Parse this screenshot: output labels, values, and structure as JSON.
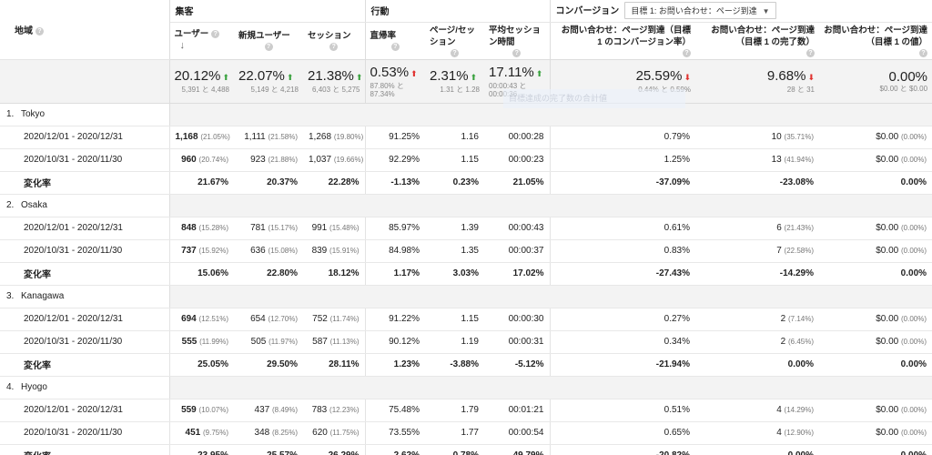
{
  "header": {
    "region_label": "地域",
    "group_acquisition": "集客",
    "group_behavior": "行動",
    "group_conversion": "コンバージョン",
    "goal_select_value": "目標 1: お問い合わせ：ページ到達",
    "columns": [
      "ユーザー",
      "新規ユーザー",
      "セッション",
      "直帰率",
      "ページ/セッション",
      "平均セッション時間",
      "お問い合わせ：ページ到達（目標 1 のコンバージョン率）",
      "お問い合わせ：ページ到達（目標 1 の完了数）",
      "お問い合わせ：ページ到達（目標 1 の値）"
    ],
    "help_icon_text": "?"
  },
  "summary": [
    {
      "value": "20.12%",
      "dir": "up",
      "sub": "5,391 と 4,488"
    },
    {
      "value": "22.07%",
      "dir": "up",
      "sub": "5,149 と 4,218"
    },
    {
      "value": "21.38%",
      "dir": "up",
      "sub": "6,403 と 5,275"
    },
    {
      "value": "0.53%",
      "dir": "up-red",
      "sub": "87.80% と 87.34%"
    },
    {
      "value": "2.31%",
      "dir": "up",
      "sub": "1.31 と 1.28"
    },
    {
      "value": "17.11%",
      "dir": "up",
      "sub": "00:00:43 と 00:00:36"
    },
    {
      "value": "25.59%",
      "dir": "down",
      "sub": "0.44% と 0.59%"
    },
    {
      "value": "9.68%",
      "dir": "down",
      "sub": "28 と 31"
    },
    {
      "value": "0.00%",
      "dir": "",
      "sub": "$0.00 と $0.00"
    }
  ],
  "tooltip_ghost": "目標達成の完了数の合計値",
  "change_label": "変化率",
  "regions": [
    {
      "index": "1.",
      "name": "Tokyo",
      "rows": [
        {
          "period": "2020/12/01 - 2020/12/31",
          "users": "1,168",
          "users_pct": "(21.05%)",
          "new": "1,111",
          "new_pct": "(21.58%)",
          "sess": "1,268",
          "sess_pct": "(19.80%)",
          "bounce": "91.25%",
          "pps": "1.16",
          "dur": "00:00:28",
          "cvr": "0.79%",
          "comp": "10",
          "comp_pct": "(35.71%)",
          "val": "$0.00",
          "val_pct": "(0.00%)"
        },
        {
          "period": "2020/10/31 - 2020/11/30",
          "users": "960",
          "users_pct": "(20.74%)",
          "new": "923",
          "new_pct": "(21.88%)",
          "sess": "1,037",
          "sess_pct": "(19.66%)",
          "bounce": "92.29%",
          "pps": "1.15",
          "dur": "00:00:23",
          "cvr": "1.25%",
          "comp": "13",
          "comp_pct": "(41.94%)",
          "val": "$0.00",
          "val_pct": "(0.00%)"
        }
      ],
      "change": [
        "21.67%",
        "20.37%",
        "22.28%",
        "-1.13%",
        "0.23%",
        "21.05%",
        "-37.09%",
        "-23.08%",
        "0.00%"
      ]
    },
    {
      "index": "2.",
      "name": "Osaka",
      "rows": [
        {
          "period": "2020/12/01 - 2020/12/31",
          "users": "848",
          "users_pct": "(15.28%)",
          "new": "781",
          "new_pct": "(15.17%)",
          "sess": "991",
          "sess_pct": "(15.48%)",
          "bounce": "85.97%",
          "pps": "1.39",
          "dur": "00:00:43",
          "cvr": "0.61%",
          "comp": "6",
          "comp_pct": "(21.43%)",
          "val": "$0.00",
          "val_pct": "(0.00%)"
        },
        {
          "period": "2020/10/31 - 2020/11/30",
          "users": "737",
          "users_pct": "(15.92%)",
          "new": "636",
          "new_pct": "(15.08%)",
          "sess": "839",
          "sess_pct": "(15.91%)",
          "bounce": "84.98%",
          "pps": "1.35",
          "dur": "00:00:37",
          "cvr": "0.83%",
          "comp": "7",
          "comp_pct": "(22.58%)",
          "val": "$0.00",
          "val_pct": "(0.00%)"
        }
      ],
      "change": [
        "15.06%",
        "22.80%",
        "18.12%",
        "1.17%",
        "3.03%",
        "17.02%",
        "-27.43%",
        "-14.29%",
        "0.00%"
      ]
    },
    {
      "index": "3.",
      "name": "Kanagawa",
      "rows": [
        {
          "period": "2020/12/01 - 2020/12/31",
          "users": "694",
          "users_pct": "(12.51%)",
          "new": "654",
          "new_pct": "(12.70%)",
          "sess": "752",
          "sess_pct": "(11.74%)",
          "bounce": "91.22%",
          "pps": "1.15",
          "dur": "00:00:30",
          "cvr": "0.27%",
          "comp": "2",
          "comp_pct": "(7.14%)",
          "val": "$0.00",
          "val_pct": "(0.00%)"
        },
        {
          "period": "2020/10/31 - 2020/11/30",
          "users": "555",
          "users_pct": "(11.99%)",
          "new": "505",
          "new_pct": "(11.97%)",
          "sess": "587",
          "sess_pct": "(11.13%)",
          "bounce": "90.12%",
          "pps": "1.19",
          "dur": "00:00:31",
          "cvr": "0.34%",
          "comp": "2",
          "comp_pct": "(6.45%)",
          "val": "$0.00",
          "val_pct": "(0.00%)"
        }
      ],
      "change": [
        "25.05%",
        "29.50%",
        "28.11%",
        "1.23%",
        "-3.88%",
        "-5.12%",
        "-21.94%",
        "0.00%",
        "0.00%"
      ]
    },
    {
      "index": "4.",
      "name": "Hyogo",
      "rows": [
        {
          "period": "2020/12/01 - 2020/12/31",
          "users": "559",
          "users_pct": "(10.07%)",
          "new": "437",
          "new_pct": "(8.49%)",
          "sess": "783",
          "sess_pct": "(12.23%)",
          "bounce": "75.48%",
          "pps": "1.79",
          "dur": "00:01:21",
          "cvr": "0.51%",
          "comp": "4",
          "comp_pct": "(14.29%)",
          "val": "$0.00",
          "val_pct": "(0.00%)"
        },
        {
          "period": "2020/10/31 - 2020/11/30",
          "users": "451",
          "users_pct": "(9.75%)",
          "new": "348",
          "new_pct": "(8.25%)",
          "sess": "620",
          "sess_pct": "(11.75%)",
          "bounce": "73.55%",
          "pps": "1.77",
          "dur": "00:00:54",
          "cvr": "0.65%",
          "comp": "4",
          "comp_pct": "(12.90%)",
          "val": "$0.00",
          "val_pct": "(0.00%)"
        }
      ],
      "change": [
        "23.95%",
        "25.57%",
        "26.29%",
        "2.62%",
        "0.78%",
        "49.79%",
        "-20.82%",
        "0.00%",
        "0.00%"
      ]
    }
  ]
}
